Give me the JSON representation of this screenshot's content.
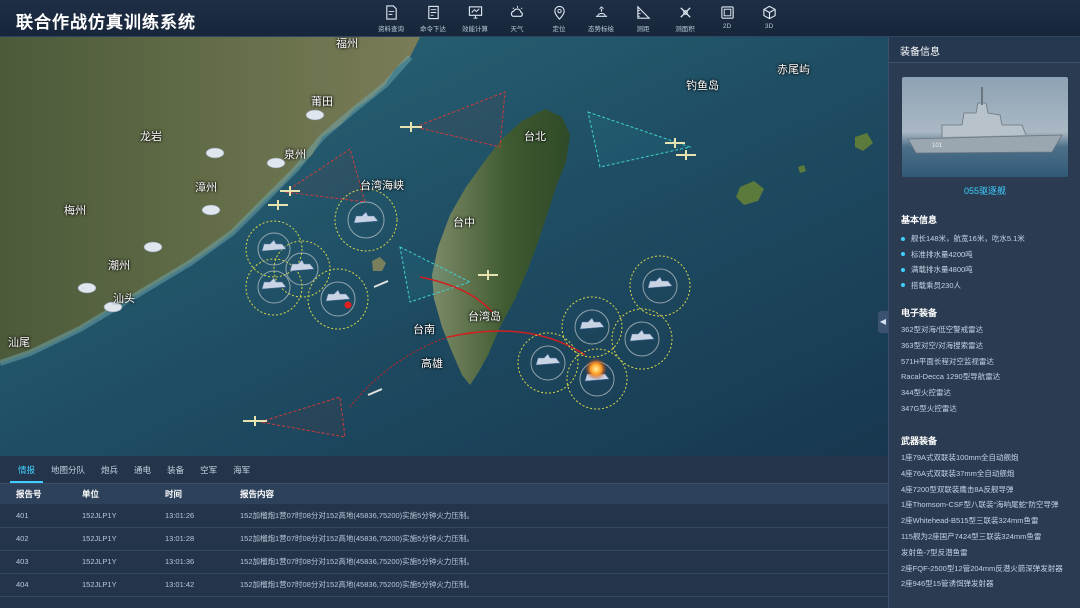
{
  "app": {
    "title": "联合作战仿真训练系统"
  },
  "toolbar": [
    {
      "label": "资料查询",
      "icon": "document-search-icon"
    },
    {
      "label": "命令下达",
      "icon": "command-doc-icon"
    },
    {
      "label": "效能计算",
      "icon": "monitor-icon"
    },
    {
      "label": "天气",
      "icon": "weather-icon"
    },
    {
      "label": "定位",
      "icon": "location-pin-icon"
    },
    {
      "label": "态势标绘",
      "icon": "plot-icon"
    },
    {
      "label": "测距",
      "icon": "ruler-icon"
    },
    {
      "label": "测面积",
      "icon": "area-measure-icon"
    },
    {
      "label": "2D",
      "icon": "2d-icon"
    },
    {
      "label": "3D",
      "icon": "3d-cube-icon"
    }
  ],
  "map": {
    "places": [
      "福州",
      "莆田",
      "龙岩",
      "泉州",
      "漳州",
      "梅州",
      "潮州",
      "汕头",
      "汕尾",
      "台湾海峡",
      "台北",
      "台中",
      "台湾岛",
      "台南",
      "高雄",
      "钓鱼岛",
      "赤尾屿"
    ],
    "colors": {
      "sea": "#1f4a5e",
      "land": "#5d6a48",
      "range_ring": "#d8d84a",
      "sector_red": "#d03a3a",
      "sector_cyan": "#40d0d0",
      "track": "#d02020"
    }
  },
  "panel": {
    "title": "装备信息",
    "ship_name": "055驱逐舰",
    "basic": {
      "title": "基本信息",
      "items": [
        "舰长148米，航宽16米，吃水5.1米",
        "标准排水量4200吨",
        "满载排水量4800吨",
        "搭载乘员230人"
      ]
    },
    "electronics": {
      "title": "电子装备",
      "items": [
        "362型对海/低空警戒雷达",
        "363型对空/对海搜索雷达",
        "571H平面长程对空监视雷达",
        "Racal-Decca 1290型导航雷达",
        "344型火控雷达",
        "347G型火控雷达"
      ]
    },
    "weapons": {
      "title": "武器装备",
      "items": [
        "1座79A式双联装100mm全自动舰炮",
        "4座76A式双联装37mm全自动舰炮",
        "4座7200型双联装鹰击8A反舰导弹",
        "1座Thomsom-CSF型八联装“海响尾蛇”防空导弹",
        "2座Whitehead-B515型三联装324mm鱼雷",
        "115舰为2座国产7424型三联装324mm鱼雷",
        "发射鱼-7型反潜鱼雷",
        "2座FQF-2500型12管204mm反潜火箭深弹发射器",
        "2座946型15管诱饵弹发射器"
      ]
    }
  },
  "report": {
    "tabs": [
      "情报",
      "地图分队",
      "炮兵",
      "通电",
      "装备",
      "空军",
      "海军"
    ],
    "active_tab": 0,
    "columns": [
      "报告号",
      "单位",
      "时间",
      "报告内容"
    ],
    "rows": [
      {
        "id": "401",
        "unit": "152JLP1Y",
        "time": "13:01:26",
        "content": "152加榴炮1营07时08分对152高地(45836,75200)实施5分钟火力压制。"
      },
      {
        "id": "402",
        "unit": "152JLP1Y",
        "time": "13:01:28",
        "content": "152加榴炮1营07时08分对152高地(45836,75200)实施5分钟火力压制。"
      },
      {
        "id": "403",
        "unit": "152JLP1Y",
        "time": "13:01:36",
        "content": "152加榴炮1营07时08分对152高地(45836,75200)实施5分钟火力压制。"
      },
      {
        "id": "404",
        "unit": "152JLP1Y",
        "time": "13:01:42",
        "content": "152加榴炮1营07时08分对152高地(45836,75200)实施5分钟火力压制。"
      }
    ]
  }
}
